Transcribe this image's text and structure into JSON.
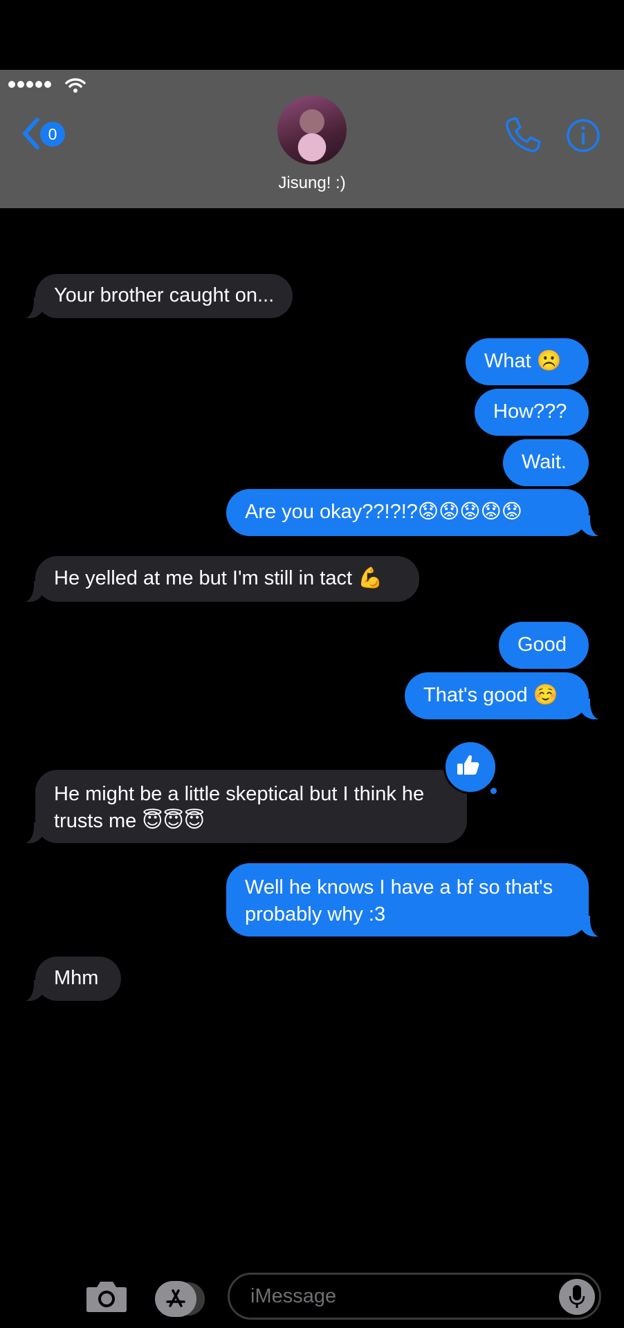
{
  "header": {
    "back_badge": "0",
    "contact_name": "Jisung! :)"
  },
  "messages": [
    {
      "from": "them",
      "text": "Your brother caught on..."
    },
    {
      "from": "me",
      "text": "What ☹️"
    },
    {
      "from": "me",
      "text": "How???"
    },
    {
      "from": "me",
      "text": "Wait."
    },
    {
      "from": "me",
      "text": "Are you okay??!?!?😟😟😟😟😟"
    },
    {
      "from": "them",
      "text": "He yelled at me but I'm still in tact 💪"
    },
    {
      "from": "me",
      "text": "Good"
    },
    {
      "from": "me",
      "text": "That's good ☺️"
    },
    {
      "from": "them",
      "text": "He might be a little skeptical but I think he trusts me 😇😇😇",
      "tapback": "thumbs-up"
    },
    {
      "from": "me",
      "text": "Well he knows I have a bf so that's probably why :3"
    },
    {
      "from": "them",
      "text": "Mhm"
    }
  ],
  "composer": {
    "placeholder": "iMessage"
  },
  "colors": {
    "accent": "#1a7cf2",
    "incoming_bubble": "#26252a",
    "header_bg": "#595959"
  }
}
